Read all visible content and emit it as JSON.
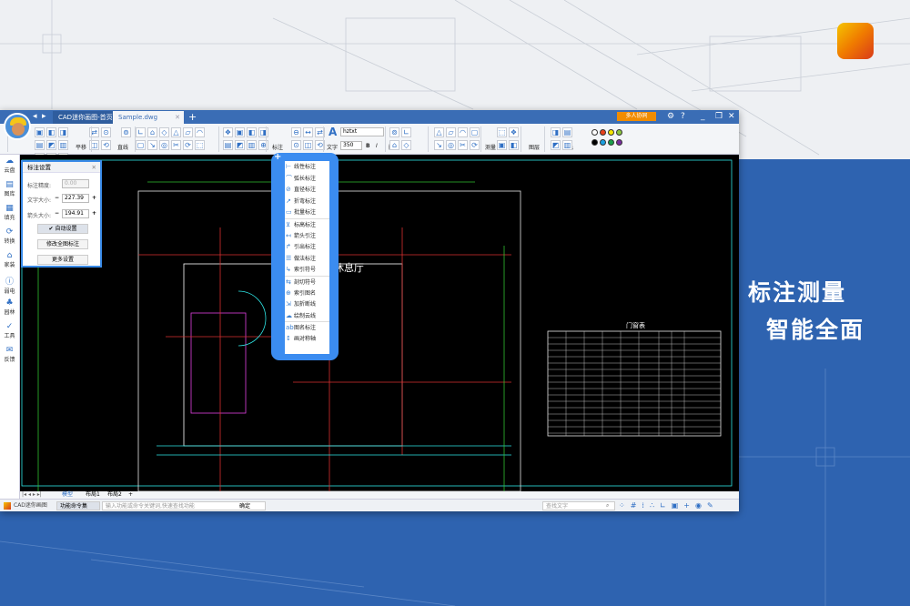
{
  "promo": {
    "headline": "标注测量",
    "subline": "智能全面"
  },
  "window": {
    "tabs": [
      "CAD迷你画图-首页",
      "Sample.dwg"
    ],
    "new_tab": "+",
    "collab": "多人协同",
    "controls": {
      "settings": "⚙",
      "help": "?",
      "minimize": "_",
      "restore": "❐",
      "close": "✕"
    }
  },
  "toolbar": {
    "labels": {
      "pan": "平移",
      "line": "直线",
      "dim": "标注",
      "text": "文字",
      "delete": "删除",
      "measure": "测量",
      "layer": "图层",
      "color": "颜色"
    },
    "font_value": "hztxt",
    "size_value": "350",
    "bold": "B",
    "italic": "I",
    "palette": [
      "#ffffff",
      "#e8401c",
      "#f5e600",
      "#8cc63f",
      "#000000",
      "#1ca0e0",
      "#1aa04a",
      "#7a2ea0"
    ]
  },
  "sidebar": [
    "云盘",
    "图库",
    "填充",
    "转换",
    "家装",
    "弱电",
    "园林",
    "工具",
    "反馈"
  ],
  "panel": {
    "title": "标注设置",
    "precision_label": "标注精度:",
    "precision_value": "0.00",
    "text_size_label": "文字大小:",
    "text_size_value": "227.39",
    "arrow_size_label": "箭头大小:",
    "arrow_size_value": "194.91",
    "minus": "−",
    "plus": "+",
    "auto": "✔ 自动设置",
    "modify_all": "修改全图标注",
    "more": "更多设置",
    "close": "✕"
  },
  "dim_menu": {
    "items": [
      "线性标注",
      "弧长标注",
      "直径标注",
      "折弯标注",
      "批量标注",
      "标高标注",
      "箭头引注",
      "引出标注",
      "做法标注",
      "索引符号",
      "剖切符号",
      "索引图名",
      "加折断线",
      "绘制云线",
      "图名标注",
      "画对称轴"
    ]
  },
  "drawing": {
    "room": "休息厅",
    "table_title": "门窗表"
  },
  "layout_tabs": [
    "模型",
    "布局1",
    "布局2"
  ],
  "status": {
    "app": "CAD迷你画图",
    "cmd_button": "功能命令集",
    "cmd_placeholder": "输入功能或命令关键词,快速查找功能",
    "ok": "确定",
    "find_placeholder": "查找文字"
  }
}
